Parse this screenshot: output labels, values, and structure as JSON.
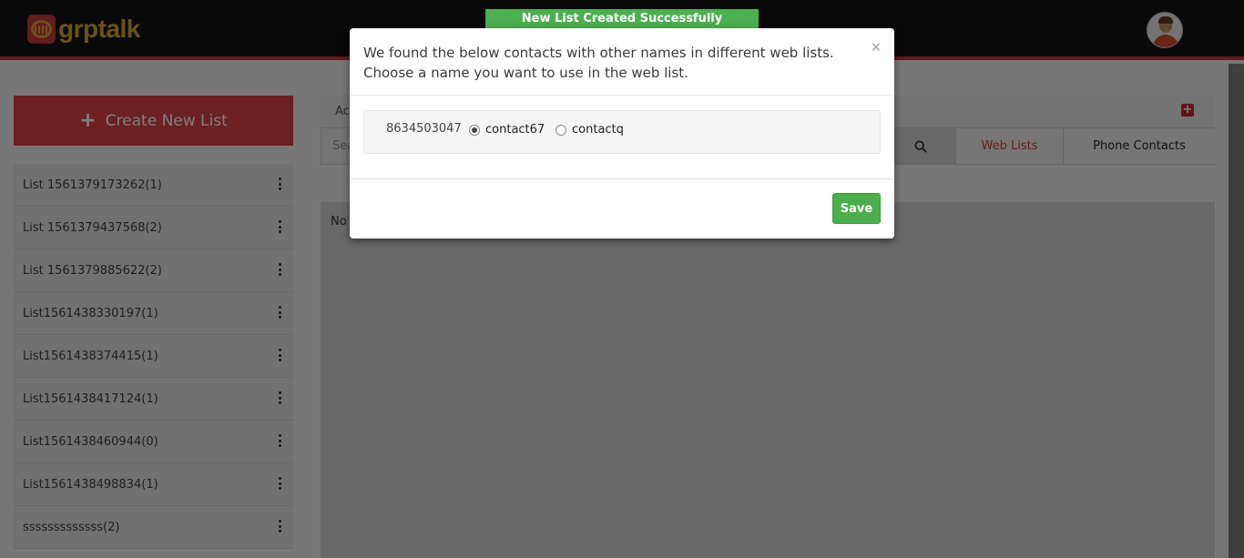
{
  "header": {
    "logo_text": "grptalk"
  },
  "sidebar": {
    "create_label": "Create New List",
    "items": [
      {
        "label": "List 1561379173262(1)"
      },
      {
        "label": "List 1561379437568(2)"
      },
      {
        "label": "List 1561379885622(2)"
      },
      {
        "label": "List1561438330197(1)"
      },
      {
        "label": "List1561438374415(1)"
      },
      {
        "label": "List1561438417124(1)"
      },
      {
        "label": "List1561438460944(0)"
      },
      {
        "label": "List1561438498834(1)"
      },
      {
        "label": "sssssssssssss(2)"
      }
    ]
  },
  "main": {
    "panel_label": "Ac",
    "search_placeholder": "Sea",
    "tabs": {
      "web_lists": "Web Lists",
      "phone_contacts": "Phone Contacts"
    },
    "content_text": "No"
  },
  "toast": {
    "message": "New List Created Successfully"
  },
  "modal": {
    "line1": "We found the below contacts with other names in different web lists.",
    "line2": "Choose a name you want to use in the web list.",
    "close": "×",
    "phone": "8634503047",
    "options": [
      "contact67",
      "contactq"
    ],
    "selected": "contact67",
    "save_label": "Save"
  },
  "colors": {
    "brand_red": "#d94145",
    "header_bg": "#131313",
    "logo_gold": "#d9a232",
    "success_green": "#4caf50"
  },
  "icons": {
    "logo": "grptalk-logo-icon",
    "avatar": "user-avatar",
    "search": "search-icon",
    "kebab": "vertical-ellipsis-icon",
    "add": "plus-square-icon"
  }
}
